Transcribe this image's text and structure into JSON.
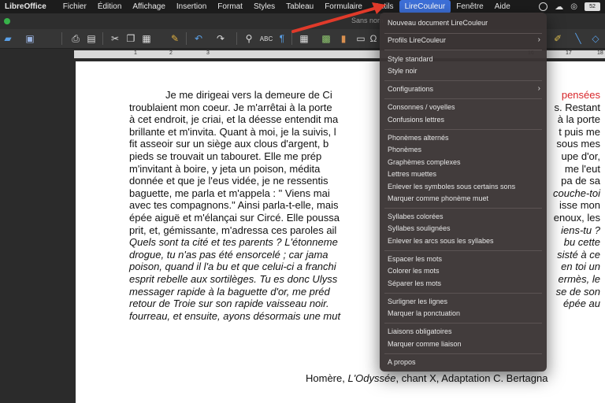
{
  "menubar": {
    "app_name": "LibreOffice",
    "items": [
      "Fichier",
      "Édition",
      "Affichage",
      "Insertion",
      "Format",
      "Styles",
      "Tableau",
      "Formulaire",
      "Outils",
      "LireCouleur",
      "Fenêtre",
      "Aide"
    ],
    "active_item": "LireCouleur",
    "battery": "52"
  },
  "title": {
    "doc_name": "Sans nom"
  },
  "ruler": [
    "1",
    "2",
    "3",
    "16",
    "17",
    "18"
  ],
  "menu": {
    "items": [
      "Nouveau document LireCouleur",
      "Profils LireCouleur",
      "Style standard",
      "Style noir",
      "Configurations",
      "Consonnes / voyelles",
      "Confusions lettres",
      "Phonèmes alternés",
      "Phonèmes",
      "Graphèmes complexes",
      "Lettres muettes",
      "Enlever les symboles sous certains sons",
      "Marquer comme phonème muet",
      "Syllabes colorées",
      "Syllabes soulignées",
      "Enlever les arcs sous les syllabes",
      "Espacer les mots",
      "Colorer les mots",
      "Séparer les mots",
      "Surligner les lignes",
      "Marquer la ponctuation",
      "Liaisons obligatoires",
      "Marquer comme liaison",
      "A propos"
    ]
  },
  "document": {
    "lines": [
      "Je me dirigeai vers la demeure de Ci",
      "pensées",
      "troublaient mon coeur. Je m'arrêtai à la porte",
      "s. Restant",
      "à cet endroit, je criai, et la déesse entendit ma",
      "à la porte",
      "brillante et m'invita. Quant à moi, je la suivis, l",
      "t puis me",
      "fit asseoir sur un siège aux clous d'argent, b",
      "sous mes",
      "pieds se trouvait un tabouret. Elle me prép",
      "upe d'or,",
      "m'invitant à boire, y jeta un poison, médita",
      "me l'eut",
      "donnée et que je l'eus vidée, je ne ressentis",
      "pa de sa",
      "baguette, me parla et m'appela : \" Viens mai",
      "couche-toi",
      "avec tes compagnons.\" Ainsi parla-t-elle, mais",
      "isse mon",
      "épée aiguë et m'élançai sur Circé. Elle poussa",
      "enoux, les",
      "prit, et, gémissante, m'adressa ces paroles ail",
      "iens-tu ?",
      "Quels sont ta cité et tes parents ? L'étonneme",
      "bu cette",
      "drogue, tu n'as pas été ensorcelé ; car jama",
      "sisté à ce",
      "poison, quand il l'a bu et que celui-ci a franchi",
      "en toi un",
      "esprit rebelle aux sortilèges. Tu es donc Ulyss",
      "ermès, le",
      "messager rapide à la baguette d'or, me préd",
      "se de son",
      "retour de Troie sur son rapide vaisseau noir.",
      "épée au",
      "fourreau, et ensuite, ayons désormais une mut"
    ],
    "signature_author": "Homère, ",
    "signature_work": "L'Odyssée",
    "signature_rest": ", chant X, Adaptation C. Bertagna"
  }
}
